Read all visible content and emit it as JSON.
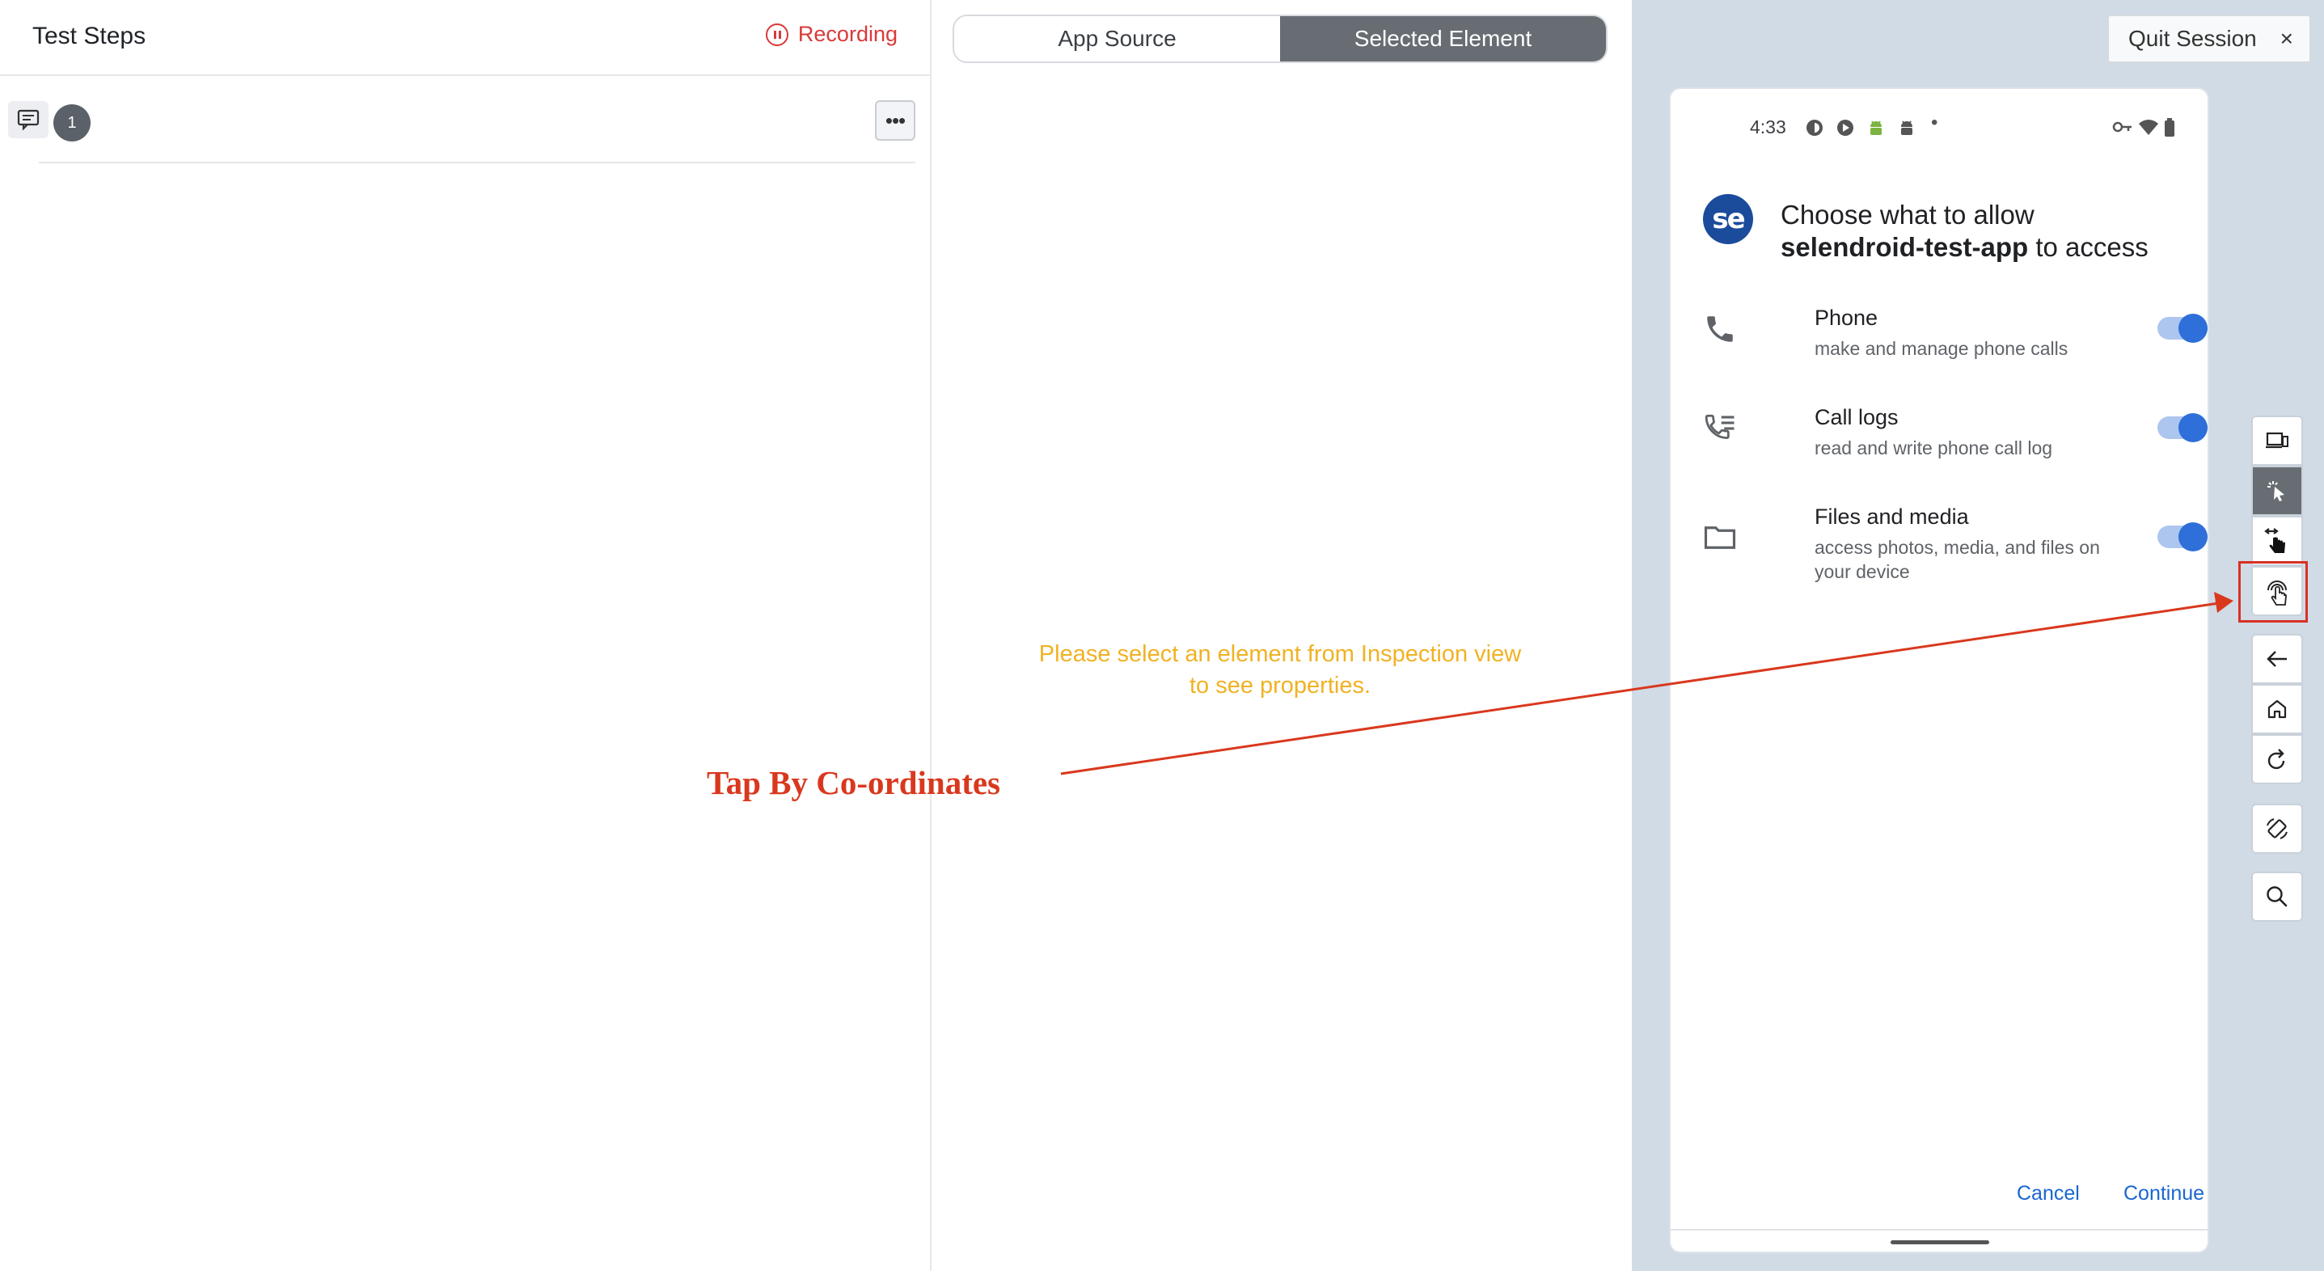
{
  "left_panel": {
    "title": "Test Steps",
    "recording_label": "Recording",
    "step": {
      "number": "1",
      "more_label": "•••"
    }
  },
  "middle_panel": {
    "tabs": [
      {
        "label": "App Source",
        "active": false
      },
      {
        "label": "Selected Element",
        "active": true
      }
    ],
    "hint_line1": "Please select an element from Inspection view",
    "hint_line2": "to see properties."
  },
  "session": {
    "quit_label": "Quit Session",
    "close_symbol": "×"
  },
  "device": {
    "status_time": "4:33",
    "status_dot": "•",
    "logo_text": "se",
    "title_prefix": "Choose what to allow",
    "app_name": "selendroid-test-app",
    "title_suffix": " to access",
    "permissions": [
      {
        "name": "Phone",
        "description": "make and manage phone calls",
        "icon": "phone-icon",
        "enabled": true
      },
      {
        "name": "Call logs",
        "description": "read and write phone call log",
        "icon": "call-log-icon",
        "enabled": true
      },
      {
        "name": "Files and media",
        "description": "access photos, media, and files on your device",
        "icon": "folder-icon",
        "enabled": true
      }
    ],
    "cancel_label": "Cancel",
    "continue_label": "Continue"
  },
  "toolbar": {
    "buttons": [
      {
        "name": "toggle-device-icon",
        "active": false
      },
      {
        "name": "select-elements-icon",
        "active": true
      },
      {
        "name": "swipe-by-coordinates-icon",
        "active": false
      },
      {
        "name": "tap-by-coordinates-icon",
        "active": false,
        "highlighted": true
      },
      {
        "name": "back-icon",
        "active": false
      },
      {
        "name": "home-icon",
        "active": false
      },
      {
        "name": "refresh-icon",
        "active": false
      },
      {
        "name": "rotate-icon",
        "active": false
      },
      {
        "name": "search-icon",
        "active": false
      }
    ]
  },
  "annotation": {
    "label": "Tap By Co-ordinates",
    "color": "#d9381e"
  },
  "colors": {
    "accent_blue": "#1a66d0",
    "recording_red": "#d93a3a",
    "hint_yellow": "#f0b224",
    "active_tab": "#676d73"
  }
}
